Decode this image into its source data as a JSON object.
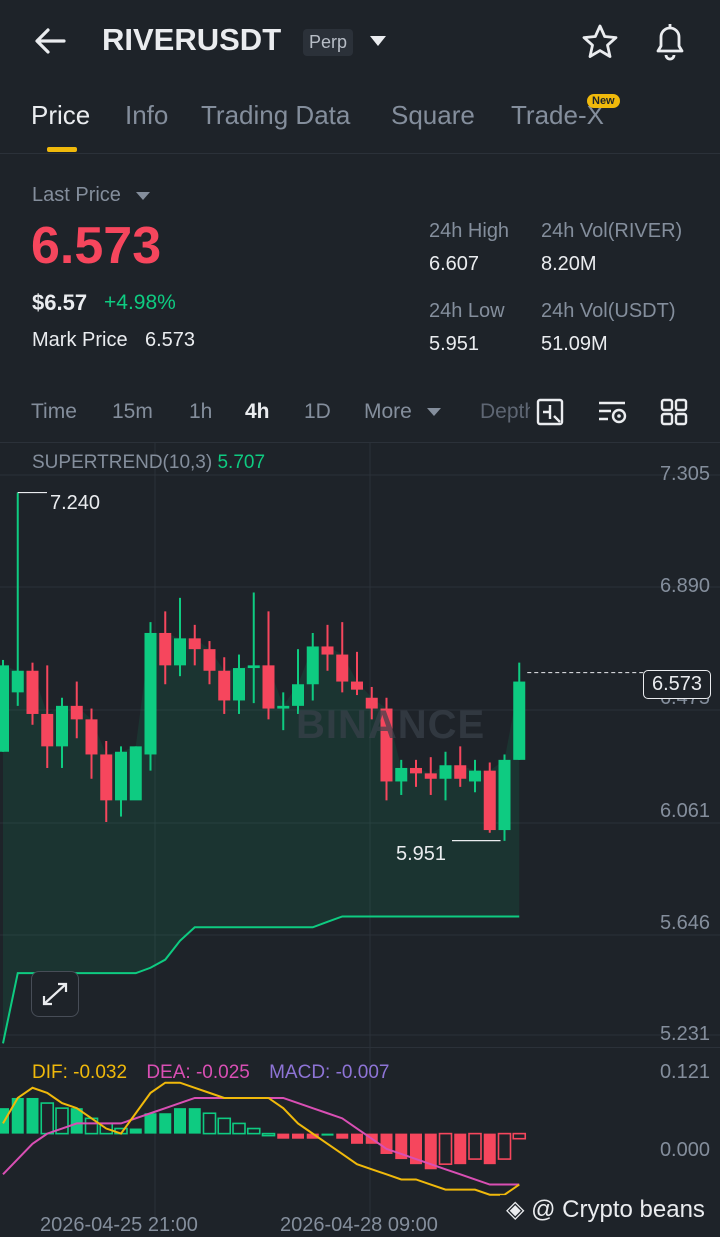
{
  "header": {
    "symbol": "RIVERUSDT",
    "badge": "Perp"
  },
  "tabs": [
    {
      "label": "Price",
      "active": true
    },
    {
      "label": "Info"
    },
    {
      "label": "Trading Data"
    },
    {
      "label": "Square"
    },
    {
      "label": "Trade-X",
      "badge": "New"
    }
  ],
  "ticker": {
    "last_price_label": "Last Price",
    "last_price": "6.573",
    "usd_price": "$6.57",
    "change_pct": "+4.98%",
    "mark_price_label": "Mark Price",
    "mark_price": "6.573",
    "stats": {
      "high_label": "24h High",
      "high": "6.607",
      "vol_river_label": "24h Vol(RIVER)",
      "vol_river": "8.20M",
      "low_label": "24h Low",
      "low": "5.951",
      "vol_usdt_label": "24h Vol(USDT)",
      "vol_usdt": "51.09M"
    }
  },
  "timeframes": [
    "Time",
    "15m",
    "1h",
    "4h",
    "1D",
    "More",
    "Depth"
  ],
  "active_timeframe": "4h",
  "indicator": {
    "name": "SUPERTREND(10,3)",
    "value": "5.707"
  },
  "macd": {
    "dif": "DIF: -0.032",
    "dea": "DEA: -0.025",
    "macd": "MACD: -0.007"
  },
  "watermark": "@ Crypto beans",
  "brand_watermark": "BINANCE",
  "colors": {
    "up": "#0ecb81",
    "down": "#f6465d",
    "accent": "#f0b90b",
    "dif": "#f0b90b",
    "dea": "#d94fb4",
    "macd": "#8e74d6"
  },
  "chart_data": {
    "type": "candlestick",
    "interval": "4h",
    "x_labels": [
      "2026-04-25 21:00",
      "2026-04-28 09:00"
    ],
    "y_ticks": [
      "7.305",
      "6.890",
      "6.475",
      "6.061",
      "5.646",
      "5.231"
    ],
    "ylim": [
      5.231,
      7.305
    ],
    "current_price": "6.573",
    "high_annotation": "7.240",
    "low_annotation": "5.951",
    "candles": [
      {
        "o": 6.28,
        "h": 6.62,
        "l": 6.28,
        "c": 6.6
      },
      {
        "o": 6.5,
        "h": 7.24,
        "l": 6.45,
        "c": 6.58
      },
      {
        "o": 6.58,
        "h": 6.61,
        "l": 6.38,
        "c": 6.42
      },
      {
        "o": 6.42,
        "h": 6.6,
        "l": 6.22,
        "c": 6.3
      },
      {
        "o": 6.3,
        "h": 6.48,
        "l": 6.22,
        "c": 6.45
      },
      {
        "o": 6.45,
        "h": 6.54,
        "l": 6.33,
        "c": 6.4
      },
      {
        "o": 6.4,
        "h": 6.44,
        "l": 6.18,
        "c": 6.27
      },
      {
        "o": 6.27,
        "h": 6.32,
        "l": 6.02,
        "c": 6.1
      },
      {
        "o": 6.1,
        "h": 6.3,
        "l": 6.04,
        "c": 6.28
      },
      {
        "o": 6.1,
        "h": 6.3,
        "l": 6.12,
        "c": 6.3
      },
      {
        "o": 6.27,
        "h": 6.76,
        "l": 6.21,
        "c": 6.72
      },
      {
        "o": 6.72,
        "h": 6.8,
        "l": 6.53,
        "c": 6.6
      },
      {
        "o": 6.6,
        "h": 6.85,
        "l": 6.56,
        "c": 6.7
      },
      {
        "o": 6.7,
        "h": 6.75,
        "l": 6.6,
        "c": 6.66
      },
      {
        "o": 6.66,
        "h": 6.69,
        "l": 6.53,
        "c": 6.58
      },
      {
        "o": 6.58,
        "h": 6.63,
        "l": 6.42,
        "c": 6.47
      },
      {
        "o": 6.47,
        "h": 6.64,
        "l": 6.42,
        "c": 6.59
      },
      {
        "o": 6.59,
        "h": 6.87,
        "l": 6.46,
        "c": 6.6
      },
      {
        "o": 6.6,
        "h": 6.8,
        "l": 6.4,
        "c": 6.44
      },
      {
        "o": 6.44,
        "h": 6.5,
        "l": 6.36,
        "c": 6.45
      },
      {
        "o": 6.45,
        "h": 6.66,
        "l": 6.42,
        "c": 6.53
      },
      {
        "o": 6.53,
        "h": 6.72,
        "l": 6.47,
        "c": 6.67
      },
      {
        "o": 6.67,
        "h": 6.75,
        "l": 6.58,
        "c": 6.64
      },
      {
        "o": 6.64,
        "h": 6.76,
        "l": 6.5,
        "c": 6.54
      },
      {
        "o": 6.54,
        "h": 6.65,
        "l": 6.49,
        "c": 6.51
      },
      {
        "o": 6.48,
        "h": 6.52,
        "l": 6.4,
        "c": 6.44
      },
      {
        "o": 6.44,
        "h": 6.48,
        "l": 6.1,
        "c": 6.17
      },
      {
        "o": 6.17,
        "h": 6.25,
        "l": 6.12,
        "c": 6.22
      },
      {
        "o": 6.22,
        "h": 6.25,
        "l": 6.15,
        "c": 6.2
      },
      {
        "o": 6.2,
        "h": 6.26,
        "l": 6.12,
        "c": 6.18
      },
      {
        "o": 6.18,
        "h": 6.28,
        "l": 6.1,
        "c": 6.23
      },
      {
        "o": 6.23,
        "h": 6.3,
        "l": 6.15,
        "c": 6.18
      },
      {
        "o": 6.17,
        "h": 6.25,
        "l": 6.13,
        "c": 6.21
      },
      {
        "o": 6.21,
        "h": 6.24,
        "l": 5.98,
        "c": 5.99
      },
      {
        "o": 5.99,
        "h": 6.27,
        "l": 5.95,
        "c": 6.25
      },
      {
        "o": 6.25,
        "h": 6.61,
        "l": 6.25,
        "c": 6.54
      }
    ],
    "supertrend": [
      5.2,
      5.46,
      5.46,
      5.46,
      5.46,
      5.46,
      5.46,
      5.46,
      5.46,
      5.46,
      5.48,
      5.51,
      5.58,
      5.63,
      5.63,
      5.63,
      5.63,
      5.63,
      5.63,
      5.63,
      5.63,
      5.63,
      5.65,
      5.67,
      5.67,
      5.67,
      5.67,
      5.67,
      5.67,
      5.67,
      5.67,
      5.67,
      5.67,
      5.67,
      5.67,
      5.67
    ],
    "macd_hist": [
      0.05,
      0.07,
      0.07,
      0.06,
      0.05,
      0.05,
      0.03,
      0.02,
      0.01,
      0.01,
      0.04,
      0.04,
      0.05,
      0.05,
      0.04,
      0.03,
      0.02,
      0.01,
      0.0,
      -0.01,
      -0.01,
      -0.01,
      0.0,
      -0.01,
      -0.02,
      -0.02,
      -0.04,
      -0.05,
      -0.06,
      -0.07,
      -0.06,
      -0.06,
      -0.05,
      -0.06,
      -0.05,
      -0.01
    ],
    "dif": [
      0.02,
      0.07,
      0.09,
      0.08,
      0.06,
      0.05,
      0.03,
      0.01,
      0.0,
      0.04,
      0.08,
      0.1,
      0.1,
      0.09,
      0.08,
      0.07,
      0.07,
      0.07,
      0.07,
      0.05,
      0.02,
      0.0,
      -0.02,
      -0.04,
      -0.06,
      -0.07,
      -0.08,
      -0.09,
      -0.09,
      -0.1,
      -0.11,
      -0.11,
      -0.11,
      -0.12,
      -0.12,
      -0.1
    ],
    "dea": [
      -0.08,
      -0.05,
      -0.02,
      0.0,
      0.01,
      0.02,
      0.02,
      0.02,
      0.02,
      0.03,
      0.04,
      0.05,
      0.06,
      0.07,
      0.07,
      0.07,
      0.07,
      0.07,
      0.07,
      0.07,
      0.06,
      0.05,
      0.04,
      0.03,
      0.01,
      -0.01,
      -0.03,
      -0.04,
      -0.05,
      -0.06,
      -0.07,
      -0.08,
      -0.09,
      -0.1,
      -0.1,
      -0.1
    ],
    "macd_ylim": [
      -0.15,
      0.121
    ],
    "macd_y_ticks": [
      "0.121",
      "0.000"
    ]
  }
}
